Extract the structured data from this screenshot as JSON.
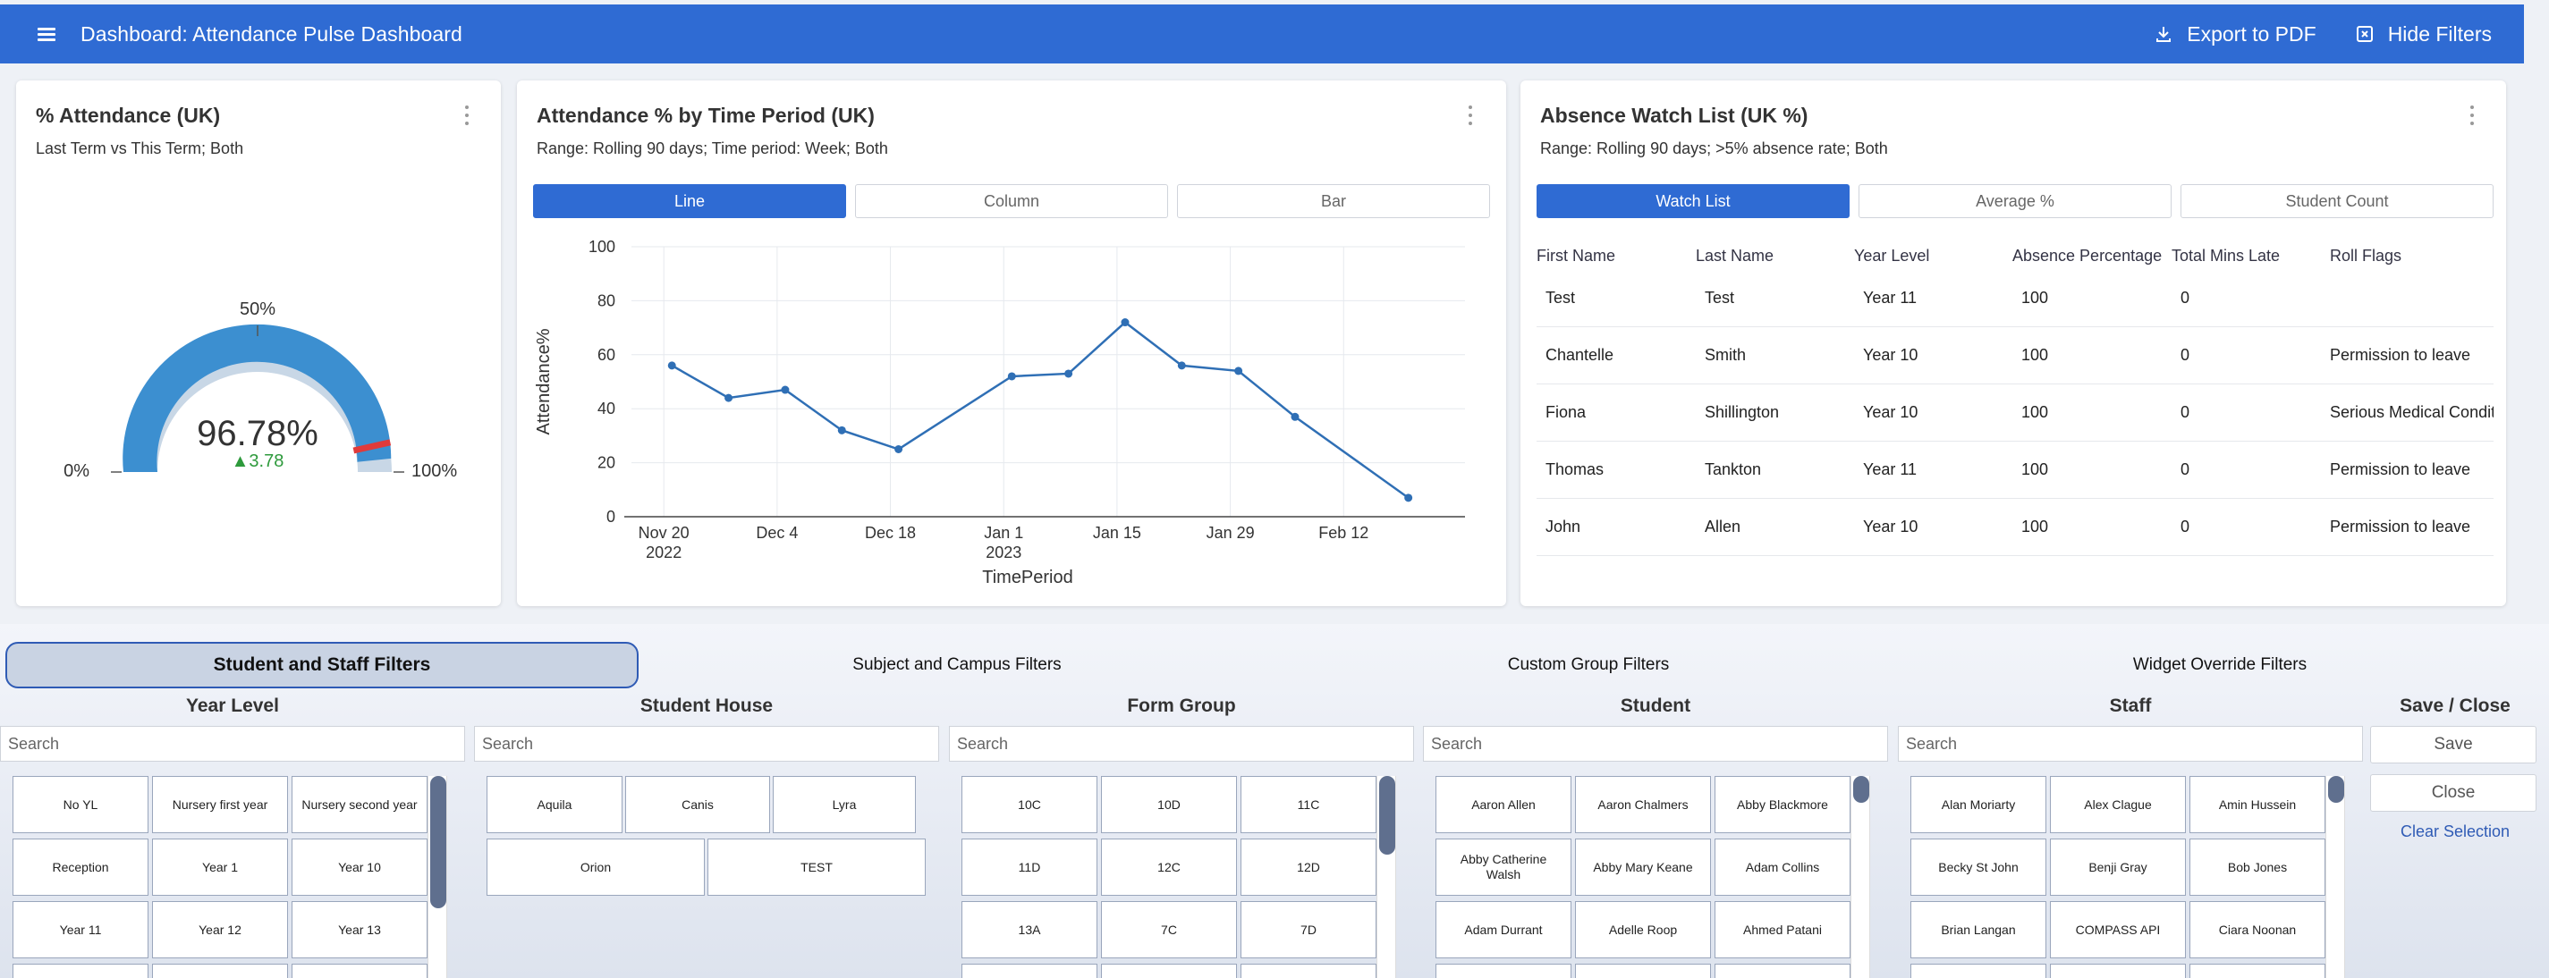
{
  "header": {
    "title": "Dashboard: Attendance Pulse Dashboard",
    "export_label": "Export to PDF",
    "hide_filters_label": "Hide Filters"
  },
  "colors": {
    "primary": "#2f6bd3",
    "gauge_fill": "#3c8fd0",
    "gauge_track": "#c8d7e6",
    "gauge_marker": "#e03a3a",
    "delta_up": "#2e9a3c",
    "line": "#2f6fb5"
  },
  "gauge": {
    "title": "% Attendance (UK)",
    "subtitle": "Last Term vs This Term; Both",
    "value_text": "96.78%",
    "value": 96.78,
    "previous_marker": 93,
    "delta_text": "▲3.78",
    "label_min": "0%",
    "label_mid": "50%",
    "label_max": "100%"
  },
  "time_chart": {
    "title": "Attendance % by Time Period (UK)",
    "subtitle": "Range: Rolling 90 days; Time period: Week; Both",
    "tabs": [
      "Line",
      "Column",
      "Bar"
    ],
    "active_tab": 0
  },
  "chart_data": {
    "type": "line",
    "x": [
      "2022-11-21",
      "2022-11-28",
      "2022-12-05",
      "2022-12-12",
      "2022-12-19",
      "2023-01-02",
      "2023-01-09",
      "2023-01-16",
      "2023-01-23",
      "2023-01-30",
      "2023-02-06",
      "2023-02-20"
    ],
    "series": [
      {
        "values": [
          56,
          44,
          47,
          32,
          25,
          52,
          53,
          72,
          56,
          54,
          37,
          7
        ]
      }
    ],
    "xlabel": "TimePeriod",
    "ylabel": "Attendance%",
    "ylim": [
      0,
      100
    ],
    "yticks": [
      "0",
      "20",
      "40",
      "60",
      "80",
      "100"
    ],
    "xticks": [
      {
        "date": "2022-11-20",
        "label": "Nov 20",
        "label2": "2022"
      },
      {
        "date": "2022-12-04",
        "label": "Dec 4",
        "label2": ""
      },
      {
        "date": "2022-12-18",
        "label": "Dec 18",
        "label2": ""
      },
      {
        "date": "2023-01-01",
        "label": "Jan 1",
        "label2": "2023"
      },
      {
        "date": "2023-01-15",
        "label": "Jan 15",
        "label2": ""
      },
      {
        "date": "2023-01-29",
        "label": "Jan 29",
        "label2": ""
      },
      {
        "date": "2023-02-12",
        "label": "Feb 12",
        "label2": ""
      }
    ],
    "grid": true
  },
  "watchlist": {
    "title": "Absence Watch List (UK %)",
    "subtitle": "Range: Rolling 90 days; >5% absence rate; Both",
    "tabs": [
      "Watch List",
      "Average %",
      "Student Count"
    ],
    "active_tab": 0,
    "columns": [
      "First Name",
      "Last Name",
      "Year Level",
      "Absence Percentage",
      "Total Mins Late",
      "Roll Flags"
    ],
    "rows": [
      [
        "Test",
        "Test",
        "Year 11",
        "100",
        "0",
        ""
      ],
      [
        "Chantelle",
        "Smith",
        "Year 10",
        "100",
        "0",
        "Permission to leave"
      ],
      [
        "Fiona",
        "Shillington",
        "Year 10",
        "100",
        "0",
        "Serious Medical Condition"
      ],
      [
        "Thomas",
        "Tankton",
        "Year 11",
        "100",
        "0",
        "Permission to leave"
      ],
      [
        "John",
        "Allen",
        "Year 10",
        "100",
        "0",
        "Permission to leave"
      ]
    ]
  },
  "filters": {
    "tabs": [
      "Student and Staff Filters",
      "Subject and Campus Filters",
      "Custom Group Filters",
      "Widget Override Filters"
    ],
    "active_tab": 0,
    "search_placeholder": "Search",
    "columns": [
      {
        "title": "Year Level",
        "items": [
          "No YL",
          "Nursery first year",
          "Nursery second year",
          "Reception",
          "Year 1",
          "Year 10",
          "Year 11",
          "Year 12",
          "Year 13"
        ]
      },
      {
        "title": "Student House",
        "items": [
          "Aquila",
          "Canis",
          "Lyra",
          "Orion",
          "TEST"
        ]
      },
      {
        "title": "Form Group",
        "items": [
          "10C",
          "10D",
          "11C",
          "11D",
          "12C",
          "12D",
          "13A",
          "7C",
          "7D"
        ]
      },
      {
        "title": "Student",
        "items": [
          "Aaron Allen",
          "Aaron Chalmers",
          "Abby Blackmore",
          "Abby Catherine Walsh",
          "Abby Mary Keane",
          "Adam Collins",
          "Adam Durrant",
          "Adelle Roop",
          "Ahmed Patani"
        ]
      },
      {
        "title": "Staff",
        "items": [
          "Alan Moriarty",
          "Alex Clague",
          "Amin Hussein",
          "Becky St John",
          "Benji Gray",
          "Bob Jones",
          "Brian Langan",
          "COMPASS API",
          "Ciara Noonan"
        ]
      }
    ],
    "save_close": {
      "title": "Save / Close",
      "save_label": "Save",
      "close_label": "Close",
      "clear_label": "Clear Selection"
    }
  }
}
